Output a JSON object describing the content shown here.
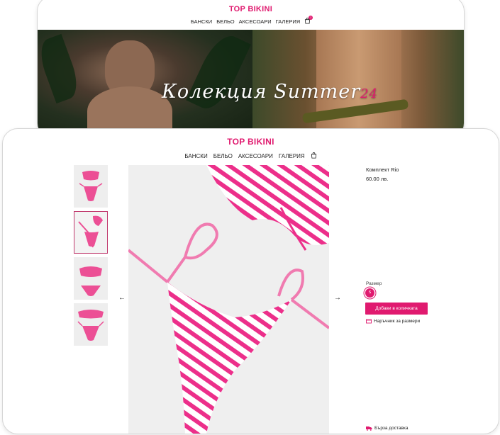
{
  "brand": "TOP BIKINI",
  "nav": {
    "items": [
      {
        "label": "БАНСКИ"
      },
      {
        "label": "БЕЛЬО"
      },
      {
        "label": "АКСЕСОАРИ"
      },
      {
        "label": "ГАЛЕРИЯ"
      }
    ],
    "cart_icon": "shopping-bag-icon",
    "cart_count": "1"
  },
  "hero": {
    "title": "Колекция Summer",
    "title_number": "24"
  },
  "product": {
    "name": "Комплект Rio",
    "price": "60.00 лв.",
    "size_label": "Размер",
    "selected_size": "S",
    "add_button": "Добави в количката",
    "size_guide": "Наръчник за размери",
    "delivery": "Бърза доставка"
  },
  "gallery": {
    "prev_icon": "arrow-left-icon",
    "next_icon": "arrow-right-icon",
    "thumbnails": 4,
    "active_thumbnail": 2
  },
  "colors": {
    "brand_pink": "#e01a6f",
    "text": "#222222"
  }
}
